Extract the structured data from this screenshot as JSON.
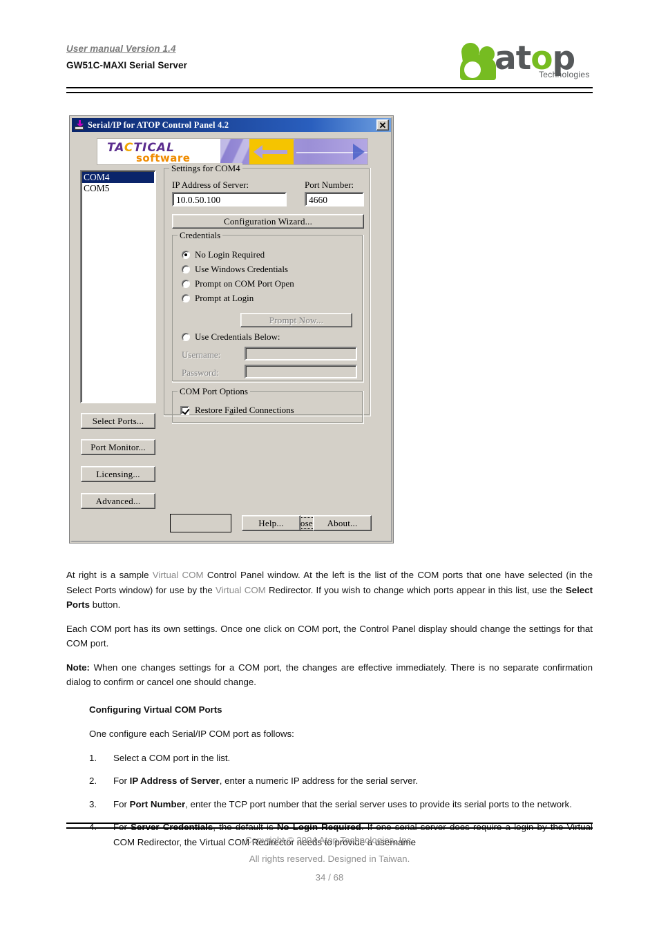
{
  "header": {
    "version": "User manual Version 1.4",
    "model": "GW51C-MAXI Serial Server",
    "logo": {
      "word_part1": "at",
      "word_accent": "o",
      "word_part2": "p",
      "subtitle": "Technologies",
      "green": "#76bc21",
      "gray": "#55585a"
    }
  },
  "dialog": {
    "title": "Serial/IP for ATOP Control Panel 4.2",
    "close_label": "✕",
    "banner": {
      "brand_top": "TACTICAL",
      "brand_top_accent": "C",
      "brand_bottom": "software"
    },
    "port_list": {
      "items": [
        {
          "label": "COM4",
          "selected": true
        },
        {
          "label": "COM5",
          "selected": false
        }
      ]
    },
    "side_buttons": [
      {
        "label": "Select Ports..."
      },
      {
        "label": "Port Monitor..."
      },
      {
        "label": "Licensing..."
      },
      {
        "label": "Advanced..."
      }
    ],
    "settings_group": {
      "title": "Settings for COM4",
      "ip_label": "IP Address of Server:",
      "ip_value": "10.0.50.100",
      "port_label": "Port Number:",
      "port_value": "4660",
      "wizard_button": "Configuration Wizard..."
    },
    "credentials_group": {
      "title": "Credentials",
      "options": [
        {
          "label": "No Login Required",
          "selected": true,
          "disabled": false
        },
        {
          "label": "Use Windows Credentials",
          "selected": false,
          "disabled": false
        },
        {
          "label": "Prompt on COM Port Open",
          "selected": false,
          "disabled": false
        },
        {
          "label": "Prompt at Login",
          "selected": false,
          "disabled": false
        },
        {
          "label": "Use Credentials Below:",
          "selected": false,
          "disabled": false
        }
      ],
      "prompt_now_button": "Prompt Now...",
      "username_label": "Username:",
      "username_value": "",
      "password_label": "Password:",
      "password_value": ""
    },
    "comport_group": {
      "title": "COM Port Options",
      "restore_label_a": "Restore F",
      "restore_label_mnemonic": "a",
      "restore_label_b": "iled Connections",
      "restore_checked": true
    },
    "bottom_buttons": {
      "close_a": "C",
      "close_b": "lose",
      "help": "Help...",
      "about": "About..."
    }
  },
  "body": {
    "para1": {
      "a": "At right is a sample ",
      "gray1": "Virtual COM",
      "b": " Control Panel window. At the left is the list of the COM ports that one have selected (in the Select Ports window) for use by the ",
      "gray2": "Virtual COM",
      "c": " Redirector.  If you wish to change which ports appear in this list, use the ",
      "bold": "Select Ports",
      "d": " button."
    },
    "para2": "Each COM port has its own settings. Once one click on COM port, the Control Panel display should change the settings for that COM port.",
    "para3": {
      "bold": "Note:",
      "text": " When one changes settings for a COM port, the changes are effective immediately.  There is no separate confirmation dialog to confirm or cancel one should change."
    },
    "subhead": "Configuring Virtual COM Ports",
    "intro": "One configure each Serial/IP COM port as follows:",
    "steps": [
      {
        "num": "1.",
        "a": "Select a COM port in the list.",
        "bold": "",
        "b": ""
      },
      {
        "num": "2.",
        "a": "For ",
        "bold": "IP Address of Server",
        "b": ", enter a numeric IP address for the serial server."
      },
      {
        "num": "3.",
        "a": "For ",
        "bold": "Port Number",
        "b": ", enter the TCP port number that the serial server uses to provide its serial ports to the network."
      },
      {
        "num": "4.",
        "a": "For ",
        "bold": "Server Credentials",
        "b": ", the default is ",
        "bold2": "No Login Required",
        "c": ". If one serial server does require a login by the Virtual COM Redirector, the Virtual COM Redirector needs to provide a username"
      }
    ]
  },
  "footer": {
    "copyright": "Copyright © 2004 Atop Technologies, Inc.",
    "rights": "All rights reserved. Designed in Taiwan.",
    "page": "34 / 68"
  }
}
